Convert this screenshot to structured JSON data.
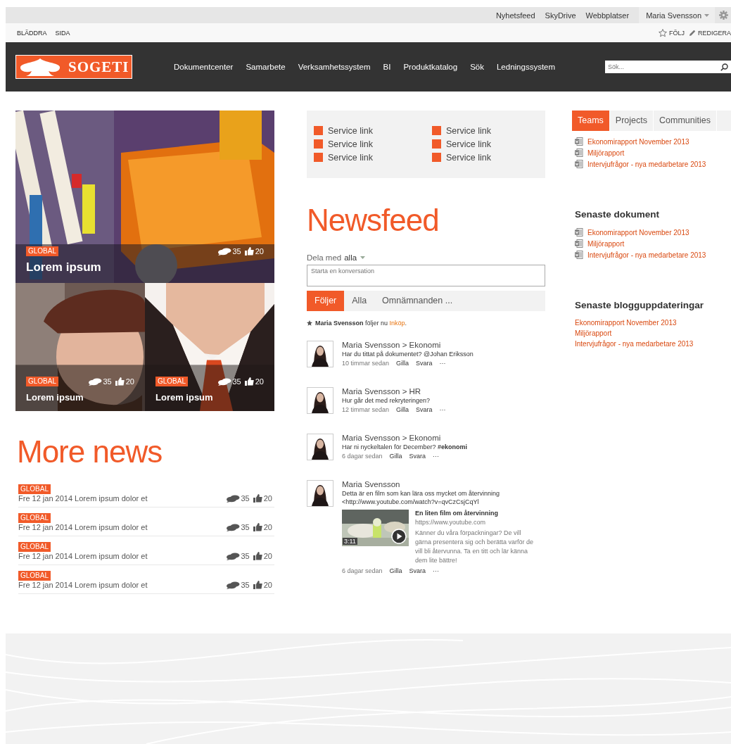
{
  "suite_bar": {
    "links": [
      "Nyhetsfeed",
      "SkyDrive",
      "Webbplatser"
    ],
    "user": "Maria Svensson"
  },
  "ribbon": {
    "tabs": [
      "BLÄDDRA",
      "SIDA"
    ],
    "actions": [
      {
        "kind": "follow",
        "label": "FÖLJ"
      },
      {
        "kind": "edit",
        "label": "REDIGERA"
      }
    ]
  },
  "header": {
    "logo": "SOGETI",
    "nav": [
      "Dokumentcenter",
      "Samarbete",
      "Verksamhetssystem",
      "BI",
      "Produktkatalog",
      "Sök",
      "Ledningssystem"
    ],
    "search": {
      "placeholder": "Sök..."
    }
  },
  "featured": [
    {
      "kind": "wide",
      "tag": "GLOBAL",
      "title": "Lorem ipsum",
      "comments": "35",
      "likes": "20"
    },
    {
      "kind": "half",
      "tag": "GLOBAL",
      "title": "Lorem ipsum",
      "comments": "35",
      "likes": "20"
    },
    {
      "kind": "half",
      "tag": "GLOBAL",
      "title": "Lorem ipsum",
      "comments": "35",
      "likes": "20"
    }
  ],
  "more_news": {
    "title": "More news",
    "items": [
      {
        "tag": "GLOBAL",
        "text": "Fre 12 jan 2014 Lorem ipsum dolor et",
        "comments": "35",
        "likes": "20"
      },
      {
        "tag": "GLOBAL",
        "text": "Fre 12 jan 2014 Lorem ipsum dolor et",
        "comments": "35",
        "likes": "20"
      },
      {
        "tag": "GLOBAL",
        "text": "Fre 12 jan 2014 Lorem ipsum dolor et",
        "comments": "35",
        "likes": "20"
      },
      {
        "tag": "GLOBAL",
        "text": "Fre 12 jan 2014 Lorem ipsum dolor et",
        "comments": "35",
        "likes": "20"
      }
    ]
  },
  "service_links": [
    "Service link",
    "Service link",
    "Service link",
    "Service link",
    "Service link",
    "Service link"
  ],
  "newsfeed": {
    "title": "Newsfeed",
    "share": {
      "label": "Dela med",
      "target": "alla"
    },
    "composer": {
      "placeholder": "Starta en konversation"
    },
    "tabs": [
      {
        "label": "Följer",
        "selected": true
      },
      {
        "label": "Alla",
        "selected": false
      },
      {
        "label": "Omnämnanden ...",
        "selected": false
      }
    ],
    "activity": {
      "actor": "Maria Svensson",
      "verb": "följer nu",
      "link": "Inköp",
      "end": "."
    },
    "posts": [
      {
        "author": "Maria Svensson > Ekonomi",
        "body": [
          "Har du tittat på dokumentet? @Johan Eriksson"
        ],
        "time": "10 timmar sedan",
        "actions": [
          "Gilla",
          "Svara",
          "···"
        ]
      },
      {
        "author": "Maria Svensson > HR",
        "body": [
          "Hur går det med rekryteringen?"
        ],
        "time": "12 timmar sedan",
        "actions": [
          "Gilla",
          "Svara",
          "···"
        ]
      },
      {
        "author": "Maria Svensson > Ekonomi",
        "body": [
          "Har ni nyckeltalen för December? **#ekonomi**"
        ],
        "time": "6 dagar sedan",
        "actions": [
          "Gilla",
          "Svara",
          "···"
        ]
      },
      {
        "author": "Maria Svensson",
        "body": [
          "Detta är en film som kan lära oss mycket om återvinning",
          "<http://www.youtube.com/watch?v=qvCzCsjCqYl"
        ],
        "attachment": {
          "kind": "picture",
          "duration": "3:11",
          "title": "En liten film om återvinning",
          "url": "https://www.youtube.com",
          "description": "Känner du våra förpackningar? De vill gärna presentera sig och berätta varför de vill bli återvunna. Ta en titt och lär känna dem lite bättre!"
        },
        "time": "6 dagar sedan",
        "actions": [
          "Gilla",
          "Svara",
          "···"
        ]
      }
    ]
  },
  "sidebar": {
    "tabs": [
      {
        "label": "Teams",
        "selected": true
      },
      {
        "label": "Projects",
        "selected": false
      },
      {
        "label": "Communities",
        "selected": false
      }
    ],
    "documents": [
      "Ekonomirapport November 2013",
      "Miljörapport",
      "Intervjufrågor - nya medarbetare 2013"
    ],
    "recent_documents": {
      "title": "Senaste dokument",
      "items": [
        "Ekonomirapport November 2013",
        "Miljörapport",
        "Intervjufrågor - nya medarbetare 2013"
      ]
    },
    "blog_updates": {
      "title": "Senaste blogguppdateringar",
      "items": [
        "Ekonomirapport November 2013",
        "Miljörapport",
        "Intervjufrågor - nya medarbetare 2013"
      ]
    }
  }
}
